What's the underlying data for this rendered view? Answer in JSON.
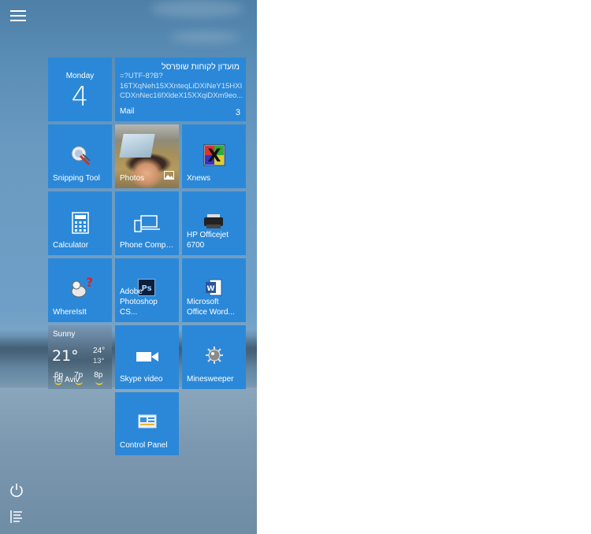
{
  "start_menu": {
    "tiles": {
      "calendar": {
        "day": "Monday",
        "date": "4"
      },
      "mail": {
        "subject": "מועדון לקוחות שופרסל",
        "body_lines": [
          "=?UTF-8?B?",
          "16TXqNeh15XXnteqLiDXINeY15HXI",
          "CDXnNec16fXldeX15XXqiDXm9eo..."
        ],
        "app_name": "Mail",
        "unread_count": "3"
      },
      "snipping_tool": {
        "label": "Snipping Tool"
      },
      "photos": {
        "label": "Photos"
      },
      "xnews": {
        "label": "Xnews"
      },
      "calculator": {
        "label": "Calculator"
      },
      "phone_companion": {
        "label": "Phone Compa..."
      },
      "hp_officejet": {
        "label": "HP Officejet 6700"
      },
      "whereisit": {
        "label": "WhereIsIt"
      },
      "photoshop": {
        "label": "Adobe Photoshop CS..."
      },
      "word": {
        "label": "Microsoft Office Word..."
      },
      "weather": {
        "condition": "Sunny",
        "temperature": "21°",
        "high": "24°",
        "low": "13°",
        "hours": [
          "6p",
          "7p",
          "8p"
        ],
        "city": "Tel Aviv"
      },
      "skype_video": {
        "label": "Skype video"
      },
      "minesweeper": {
        "label": "Minesweeper"
      },
      "control_panel": {
        "label": "Control Panel"
      }
    }
  },
  "colors": {
    "tile_blue": "#2b88d8",
    "page_background": "#ffffff"
  },
  "icons": {
    "menu": "hamburger-menu-icon",
    "power": "power-icon",
    "all_apps": "all-apps-list-icon"
  }
}
